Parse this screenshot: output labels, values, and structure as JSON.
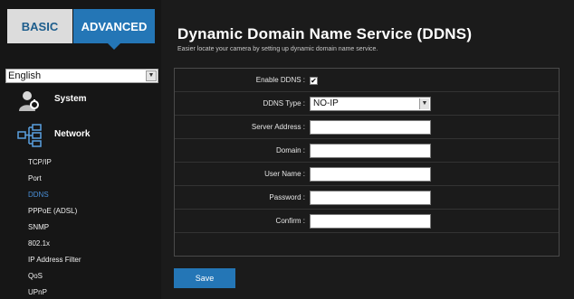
{
  "tabs": {
    "basic": "BASIC",
    "advanced": "ADVANCED"
  },
  "language": {
    "selected": "English"
  },
  "nav": {
    "system": "System",
    "network": "Network",
    "subitems": [
      "TCP/IP",
      "Port",
      "DDNS",
      "PPPoE (ADSL)",
      "SNMP",
      "802.1x",
      "IP Address Filter",
      "QoS",
      "UPnP"
    ],
    "active_subitem": "DDNS"
  },
  "page": {
    "title": "Dynamic Domain Name Service (DDNS)",
    "subtitle": "Easier locate your camera by setting up dynamic domain name service."
  },
  "form": {
    "enable_label": "Enable DDNS :",
    "enable_checked": true,
    "type_label": "DDNS Type :",
    "type_value": "NO-IP",
    "server_label": "Server Address :",
    "server_value": "",
    "domain_label": "Domain :",
    "domain_value": "",
    "user_label": "User Name :",
    "user_value": "",
    "password_label": "Password :",
    "password_value": "",
    "confirm_label": "Confirm :",
    "confirm_value": ""
  },
  "buttons": {
    "save": "Save"
  },
  "colors": {
    "accent": "#2476b6",
    "background": "#1b1b1b",
    "active_link": "#4a90d9"
  },
  "icons": {
    "system": "admin-user-icon",
    "network": "network-tree-icon",
    "dropdown": "chevron-down-icon"
  }
}
